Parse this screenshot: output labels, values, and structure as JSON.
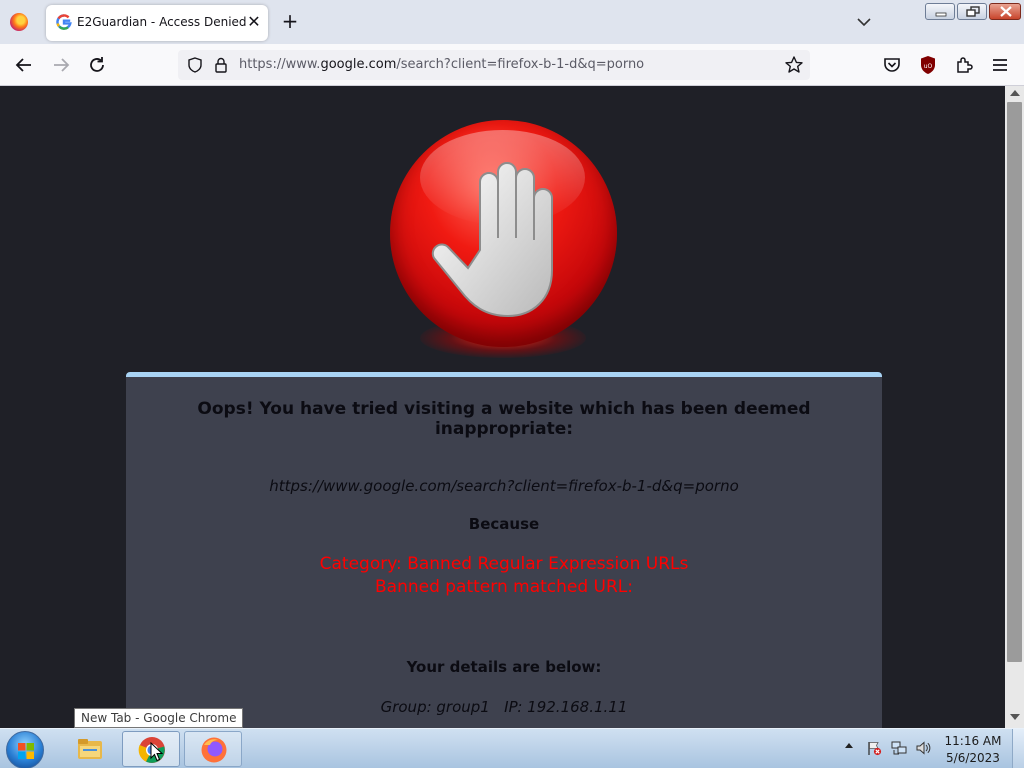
{
  "browser": {
    "tab_title": "E2Guardian - Access Denied",
    "tab_close": "✕",
    "new_tab": "+",
    "url_prefix": "https://www.",
    "url_host": "google.com",
    "url_rest": "/search?client=firefox-b-1-d&q=porno",
    "icons": [
      "firefox-logo-icon",
      "google-favicon-icon",
      "chevron-down-icon",
      "back-arrow-icon",
      "forward-arrow-icon",
      "reload-icon",
      "shield-icon",
      "lock-icon",
      "star-icon",
      "pocket-icon",
      "ublock-origin-icon",
      "extensions-icon",
      "hamburger-menu-icon"
    ]
  },
  "block_page": {
    "title": "Oops! You have tried visiting a website which has been deemed inappropriate:",
    "blocked_url": "https://www.google.com/search?client=firefox-b-1-d&q=porno",
    "because": "Because",
    "reason_category": "Category: Banned Regular Expression URLs",
    "reason_pattern": "Banned pattern matched URL:",
    "details_heading": "Your details are below:",
    "details_line": "Group: group1   IP: 192.168.1.11",
    "colors": {
      "reason": "#ff0000",
      "card": "#3e414e",
      "card_border": "#a9d4f5",
      "background": "#1f2027"
    }
  },
  "taskbar": {
    "tooltip": "New Tab - Google Chrome",
    "clock_time": "11:16 AM",
    "clock_date": "5/6/2023",
    "apps": [
      "windows-explorer",
      "google-chrome",
      "firefox"
    ]
  }
}
